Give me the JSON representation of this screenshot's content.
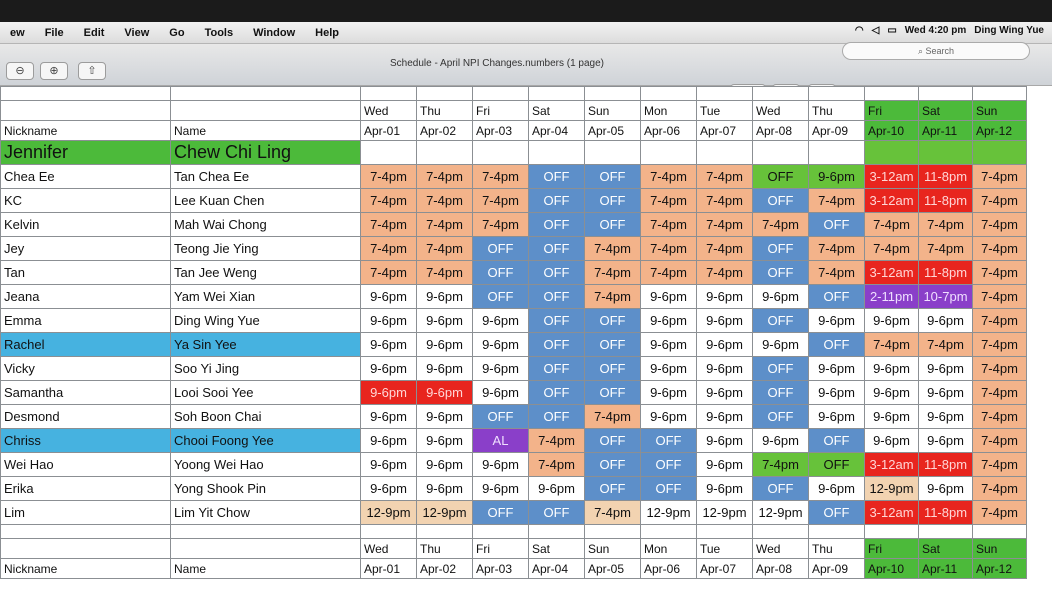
{
  "menubar": {
    "items": [
      "ew",
      "File",
      "Edit",
      "View",
      "Go",
      "Tools",
      "Window",
      "Help"
    ],
    "clock": "Wed 4:20 pm",
    "user": "Ding Wing Yue"
  },
  "window": {
    "title": "Schedule - April NPI Changes.numbers (1 page)",
    "search_placeholder": "Search"
  },
  "table": {
    "nickname_header": "Nickname",
    "name_header": "Name",
    "days": [
      "Wed",
      "Thu",
      "Fri",
      "Sat",
      "Sun",
      "Mon",
      "Tue",
      "Wed",
      "Thu",
      "Fri",
      "Sat",
      "Sun"
    ],
    "dates": [
      "Apr-01",
      "Apr-02",
      "Apr-03",
      "Apr-04",
      "Apr-05",
      "Apr-06",
      "Apr-07",
      "Apr-08",
      "Apr-09",
      "Apr-10",
      "Apr-11",
      "Apr-12"
    ],
    "manager": {
      "nickname": "Jennifer",
      "name": "Chew Chi Ling"
    },
    "rows": [
      {
        "nickname": "Chea Ee",
        "name": "Tan Chea Ee",
        "shifts": [
          "7-4pm",
          "7-4pm",
          "7-4pm",
          "OFF",
          "OFF",
          "7-4pm",
          "7-4pm",
          "OFF",
          "9-6pm",
          "3-12am",
          "11-8pm",
          "7-4pm"
        ],
        "colors": [
          "orange",
          "orange",
          "orange",
          "blue",
          "blue",
          "orange",
          "orange",
          "green",
          "green",
          "red",
          "red",
          "orange"
        ]
      },
      {
        "nickname": "KC",
        "name": "Lee Kuan Chen",
        "shifts": [
          "7-4pm",
          "7-4pm",
          "7-4pm",
          "OFF",
          "OFF",
          "7-4pm",
          "7-4pm",
          "OFF",
          "7-4pm",
          "3-12am",
          "11-8pm",
          "7-4pm"
        ],
        "colors": [
          "orange",
          "orange",
          "orange",
          "blue",
          "blue",
          "orange",
          "orange",
          "blue",
          "orange",
          "red",
          "red",
          "orange"
        ]
      },
      {
        "nickname": "Kelvin",
        "name": "Mah Wai Chong",
        "shifts": [
          "7-4pm",
          "7-4pm",
          "7-4pm",
          "OFF",
          "OFF",
          "7-4pm",
          "7-4pm",
          "7-4pm",
          "OFF",
          "7-4pm",
          "7-4pm",
          "7-4pm"
        ],
        "colors": [
          "orange",
          "orange",
          "orange",
          "blue",
          "blue",
          "orange",
          "orange",
          "orange",
          "blue",
          "orange",
          "orange",
          "orange"
        ]
      },
      {
        "nickname": "Jey",
        "name": "Teong Jie Ying",
        "shifts": [
          "7-4pm",
          "7-4pm",
          "OFF",
          "OFF",
          "7-4pm",
          "7-4pm",
          "7-4pm",
          "OFF",
          "7-4pm",
          "7-4pm",
          "7-4pm",
          "7-4pm"
        ],
        "colors": [
          "orange",
          "orange",
          "blue",
          "blue",
          "orange",
          "orange",
          "orange",
          "blue",
          "orange",
          "orange",
          "orange",
          "orange"
        ]
      },
      {
        "nickname": "Tan",
        "name": "Tan Jee Weng",
        "shifts": [
          "7-4pm",
          "7-4pm",
          "OFF",
          "OFF",
          "7-4pm",
          "7-4pm",
          "7-4pm",
          "OFF",
          "7-4pm",
          "3-12am",
          "11-8pm",
          "7-4pm"
        ],
        "colors": [
          "orange",
          "orange",
          "blue",
          "blue",
          "orange",
          "orange",
          "orange",
          "blue",
          "orange",
          "red",
          "red",
          "orange"
        ]
      },
      {
        "nickname": "Jeana",
        "name": "Yam Wei Xian",
        "shifts": [
          "9-6pm",
          "9-6pm",
          "OFF",
          "OFF",
          "7-4pm",
          "9-6pm",
          "9-6pm",
          "9-6pm",
          "OFF",
          "2-11pm",
          "10-7pm",
          "7-4pm"
        ],
        "colors": [
          "white",
          "white",
          "blue",
          "blue",
          "orange",
          "white",
          "white",
          "white",
          "blue",
          "purple",
          "purple",
          "orange"
        ]
      },
      {
        "nickname": "Emma",
        "name": "Ding Wing Yue",
        "shifts": [
          "9-6pm",
          "9-6pm",
          "9-6pm",
          "OFF",
          "OFF",
          "9-6pm",
          "9-6pm",
          "OFF",
          "9-6pm",
          "9-6pm",
          "9-6pm",
          "7-4pm"
        ],
        "colors": [
          "white",
          "white",
          "white",
          "blue",
          "blue",
          "white",
          "white",
          "blue",
          "white",
          "white",
          "white",
          "orange"
        ]
      },
      {
        "nickname": "Rachel",
        "name": "Ya Sin Yee",
        "shifts": [
          "9-6pm",
          "9-6pm",
          "9-6pm",
          "OFF",
          "OFF",
          "9-6pm",
          "9-6pm",
          "9-6pm",
          "OFF",
          "7-4pm",
          "7-4pm",
          "7-4pm"
        ],
        "colors": [
          "white",
          "white",
          "white",
          "blue",
          "blue",
          "white",
          "white",
          "white",
          "blue",
          "orange",
          "orange",
          "orange"
        ]
      },
      {
        "nickname": "Vicky",
        "name": "Soo Yi Jing",
        "shifts": [
          "9-6pm",
          "9-6pm",
          "9-6pm",
          "OFF",
          "OFF",
          "9-6pm",
          "9-6pm",
          "OFF",
          "9-6pm",
          "9-6pm",
          "9-6pm",
          "7-4pm"
        ],
        "colors": [
          "white",
          "white",
          "white",
          "blue",
          "blue",
          "white",
          "white",
          "blue",
          "white",
          "white",
          "white",
          "orange"
        ]
      },
      {
        "nickname": "Samantha",
        "name": "Looi Sooi Yee",
        "shifts": [
          "9-6pm",
          "9-6pm",
          "9-6pm",
          "OFF",
          "OFF",
          "9-6pm",
          "9-6pm",
          "OFF",
          "9-6pm",
          "9-6pm",
          "9-6pm",
          "7-4pm"
        ],
        "colors": [
          "red",
          "red",
          "white",
          "blue",
          "blue",
          "white",
          "white",
          "blue",
          "white",
          "white",
          "white",
          "orange"
        ]
      },
      {
        "nickname": "Desmond",
        "name": "Soh Boon Chai",
        "shifts": [
          "9-6pm",
          "9-6pm",
          "OFF",
          "OFF",
          "7-4pm",
          "9-6pm",
          "9-6pm",
          "OFF",
          "9-6pm",
          "9-6pm",
          "9-6pm",
          "7-4pm"
        ],
        "colors": [
          "white",
          "white",
          "blue",
          "blue",
          "orange",
          "white",
          "white",
          "blue",
          "white",
          "white",
          "white",
          "orange"
        ]
      },
      {
        "nickname": "Chriss",
        "name": "Chooi Foong Yee",
        "shifts": [
          "9-6pm",
          "9-6pm",
          "AL",
          "7-4pm",
          "OFF",
          "OFF",
          "9-6pm",
          "9-6pm",
          "OFF",
          "9-6pm",
          "9-6pm",
          "7-4pm"
        ],
        "colors": [
          "white",
          "white",
          "purple",
          "orange",
          "blue",
          "blue",
          "white",
          "white",
          "blue",
          "white",
          "white",
          "orange"
        ]
      },
      {
        "nickname": "Wei Hao",
        "name": "Yoong Wei Hao",
        "shifts": [
          "9-6pm",
          "9-6pm",
          "9-6pm",
          "7-4pm",
          "OFF",
          "OFF",
          "9-6pm",
          "7-4pm",
          "OFF",
          "3-12am",
          "11-8pm",
          "7-4pm"
        ],
        "colors": [
          "white",
          "white",
          "white",
          "orange",
          "blue",
          "blue",
          "white",
          "green",
          "green",
          "red",
          "red",
          "orange"
        ]
      },
      {
        "nickname": "Erika",
        "name": "Yong Shook Pin",
        "shifts": [
          "9-6pm",
          "9-6pm",
          "9-6pm",
          "9-6pm",
          "OFF",
          "OFF",
          "9-6pm",
          "OFF",
          "9-6pm",
          "12-9pm",
          "9-6pm",
          "7-4pm"
        ],
        "colors": [
          "white",
          "white",
          "white",
          "white",
          "blue",
          "blue",
          "white",
          "blue",
          "white",
          "tan",
          "white",
          "orange"
        ]
      },
      {
        "nickname": "Lim",
        "name": "Lim Yit Chow",
        "shifts": [
          "12-9pm",
          "12-9pm",
          "OFF",
          "OFF",
          "7-4pm",
          "12-9pm",
          "12-9pm",
          "12-9pm",
          "OFF",
          "3-12am",
          "11-8pm",
          "7-4pm"
        ],
        "colors": [
          "tan",
          "tan",
          "blue",
          "blue",
          "tan",
          "white",
          "white",
          "white",
          "blue",
          "red",
          "red",
          "orange"
        ]
      }
    ],
    "footer_nickname": "Nickname",
    "footer_name": "Name"
  }
}
